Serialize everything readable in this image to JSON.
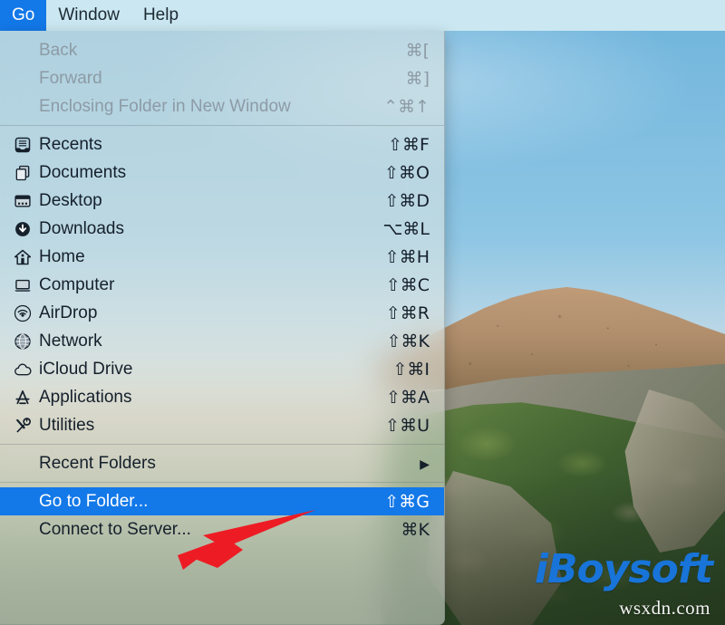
{
  "menubar": {
    "items": [
      {
        "label": "Go",
        "active": true
      },
      {
        "label": "Window",
        "active": false
      },
      {
        "label": "Help",
        "active": false
      }
    ]
  },
  "menu": {
    "title": "Go",
    "accent_color": "#1378e8",
    "groups": [
      {
        "items": [
          {
            "icon": "none",
            "label": "Back",
            "shortcut": "⌘[",
            "disabled": true,
            "selected": false,
            "submenu": false
          },
          {
            "icon": "none",
            "label": "Forward",
            "shortcut": "⌘]",
            "disabled": true,
            "selected": false,
            "submenu": false
          },
          {
            "icon": "none",
            "label": "Enclosing Folder in New Window",
            "shortcut": "⌃⌘↑",
            "disabled": true,
            "selected": false,
            "submenu": false
          }
        ]
      },
      {
        "items": [
          {
            "icon": "recents-icon",
            "label": "Recents",
            "shortcut": "⇧⌘F",
            "disabled": false,
            "selected": false,
            "submenu": false
          },
          {
            "icon": "documents-icon",
            "label": "Documents",
            "shortcut": "⇧⌘O",
            "disabled": false,
            "selected": false,
            "submenu": false
          },
          {
            "icon": "desktop-icon",
            "label": "Desktop",
            "shortcut": "⇧⌘D",
            "disabled": false,
            "selected": false,
            "submenu": false
          },
          {
            "icon": "downloads-icon",
            "label": "Downloads",
            "shortcut": "⌥⌘L",
            "disabled": false,
            "selected": false,
            "submenu": false
          },
          {
            "icon": "home-icon",
            "label": "Home",
            "shortcut": "⇧⌘H",
            "disabled": false,
            "selected": false,
            "submenu": false
          },
          {
            "icon": "computer-icon",
            "label": "Computer",
            "shortcut": "⇧⌘C",
            "disabled": false,
            "selected": false,
            "submenu": false
          },
          {
            "icon": "airdrop-icon",
            "label": "AirDrop",
            "shortcut": "⇧⌘R",
            "disabled": false,
            "selected": false,
            "submenu": false
          },
          {
            "icon": "network-icon",
            "label": "Network",
            "shortcut": "⇧⌘K",
            "disabled": false,
            "selected": false,
            "submenu": false
          },
          {
            "icon": "icloud-icon",
            "label": "iCloud Drive",
            "shortcut": "⇧⌘I",
            "disabled": false,
            "selected": false,
            "submenu": false
          },
          {
            "icon": "applications-icon",
            "label": "Applications",
            "shortcut": "⇧⌘A",
            "disabled": false,
            "selected": false,
            "submenu": false
          },
          {
            "icon": "utilities-icon",
            "label": "Utilities",
            "shortcut": "⇧⌘U",
            "disabled": false,
            "selected": false,
            "submenu": false
          }
        ]
      },
      {
        "items": [
          {
            "icon": "none",
            "label": "Recent Folders",
            "shortcut": "",
            "disabled": false,
            "selected": false,
            "submenu": true
          }
        ]
      },
      {
        "items": [
          {
            "icon": "none",
            "label": "Go to Folder...",
            "shortcut": "⇧⌘G",
            "disabled": false,
            "selected": true,
            "submenu": false
          },
          {
            "icon": "none",
            "label": "Connect to Server...",
            "shortcut": "⌘K",
            "disabled": false,
            "selected": false,
            "submenu": false
          }
        ]
      }
    ]
  },
  "annotation": {
    "arrow_color": "#ed1c24",
    "points_to": "Go to Folder..."
  },
  "watermark": {
    "logo": "iBoysoft",
    "url": "wsxdn.com",
    "logo_color": "#1874d8"
  }
}
